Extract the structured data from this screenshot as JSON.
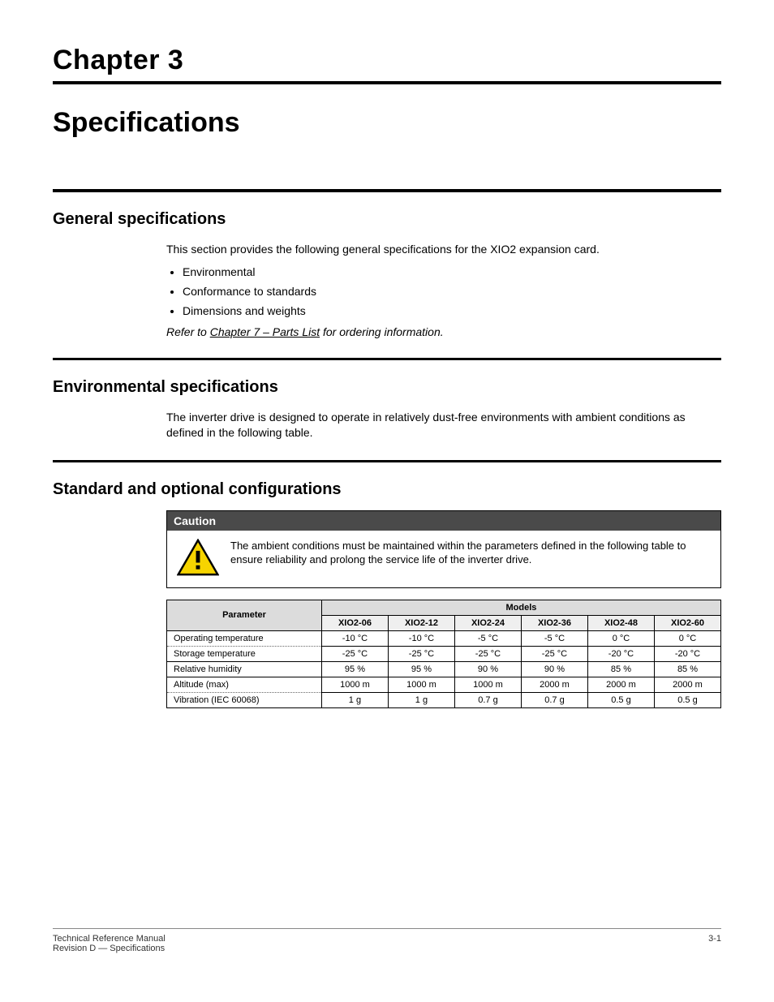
{
  "chapter": {
    "label": "Chapter 3",
    "title": "Specifications"
  },
  "section_general": {
    "title": "General specifications",
    "intro": "This section provides the following general specifications for the XIO2 expansion card.",
    "bullets": [
      "Environmental",
      "Conformance to standards",
      "Dimensions and weights"
    ],
    "refer_prefix": "Refer to ",
    "refer_link": "Chapter 7 – Parts List",
    "refer_suffix": " for ordering information."
  },
  "section_env": {
    "title": "Environmental specifications",
    "body": "The inverter drive is designed to operate in relatively dust-free environments with ambient conditions as defined in the following table."
  },
  "config_heading": "Standard and optional configurations",
  "caution": {
    "header": "Caution",
    "text": "The ambient conditions must be maintained within the parameters defined in the following table to ensure reliability and prolong the service life of the inverter drive."
  },
  "table": {
    "group_header": "Parameter",
    "model_header": "Models",
    "models": [
      "XIO2-06",
      "XIO2-12",
      "XIO2-24",
      "XIO2-36",
      "XIO2-48",
      "XIO2-60"
    ],
    "rows": [
      {
        "label": "Operating temperature",
        "cells": [
          "-10 °C",
          "-10 °C",
          "-5 °C",
          "-5 °C",
          "0 °C",
          "0 °C"
        ]
      },
      {
        "label": "Storage temperature",
        "cells": [
          "-25 °C",
          "-25 °C",
          "-25 °C",
          "-25 °C",
          "-20 °C",
          "-20 °C"
        ]
      },
      {
        "label": "Relative humidity",
        "cells": [
          "95 %",
          "95 %",
          "90 %",
          "90 %",
          "85 %",
          "85 %"
        ]
      },
      {
        "label": "Altitude (max)",
        "cells": [
          "1000 m",
          "1000 m",
          "1000 m",
          "2000 m",
          "2000 m",
          "2000 m"
        ]
      },
      {
        "label": "Vibration (IEC 60068)",
        "cells": [
          "1 g",
          "1 g",
          "0.7 g",
          "0.7 g",
          "0.5 g",
          "0.5 g"
        ]
      }
    ]
  },
  "footer": {
    "left": "Technical Reference Manual\nRevision D — Specifications",
    "right": "3-1"
  }
}
